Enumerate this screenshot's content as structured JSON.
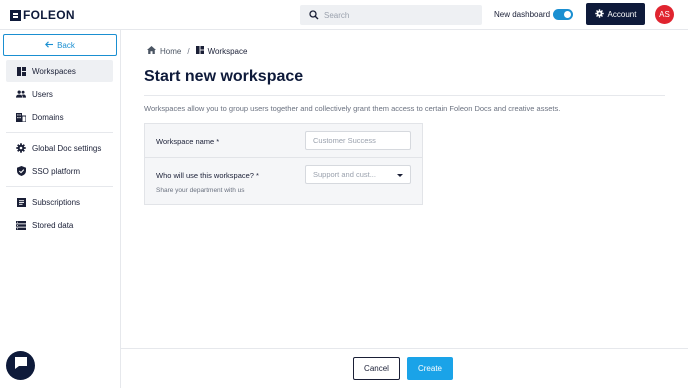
{
  "app": {
    "logo_text": "FOLEON"
  },
  "header": {
    "search_placeholder": "Search",
    "new_dashboard_label": "New dashboard",
    "new_dashboard_enabled": true,
    "account_label": "Account",
    "avatar_initials": "AS",
    "accent_color": "#1a8fd1",
    "brand_color": "#0e1a3a",
    "avatar_color": "#e0242f"
  },
  "sidebar": {
    "back_label": "Back",
    "items": [
      {
        "label": "Workspaces",
        "icon": "workspaces-icon",
        "active": true
      },
      {
        "label": "Users",
        "icon": "users-icon",
        "active": false
      },
      {
        "label": "Domains",
        "icon": "domains-icon",
        "active": false
      },
      {
        "label": "Global Doc settings",
        "icon": "gear-icon",
        "active": false
      },
      {
        "label": "SSO platform",
        "icon": "shield-icon",
        "active": false
      },
      {
        "label": "Subscriptions",
        "icon": "subscriptions-icon",
        "active": false
      },
      {
        "label": "Stored data",
        "icon": "stored-data-icon",
        "active": false
      }
    ]
  },
  "breadcrumb": {
    "home": "Home",
    "separator": "/",
    "current": "Workspace"
  },
  "main": {
    "title": "Start new workspace",
    "description": "Workspaces allow you to group users together and collectively grant them access to certain Foleon Docs and creative assets.",
    "form": {
      "name_label": "Workspace name *",
      "name_placeholder": "Customer Success",
      "usage_label": "Who will use this workspace? *",
      "usage_hint": "Share your department with us",
      "usage_selected": "Support and cust..."
    }
  },
  "footer": {
    "cancel_label": "Cancel",
    "create_label": "Create",
    "create_color": "#1aa3e8"
  }
}
